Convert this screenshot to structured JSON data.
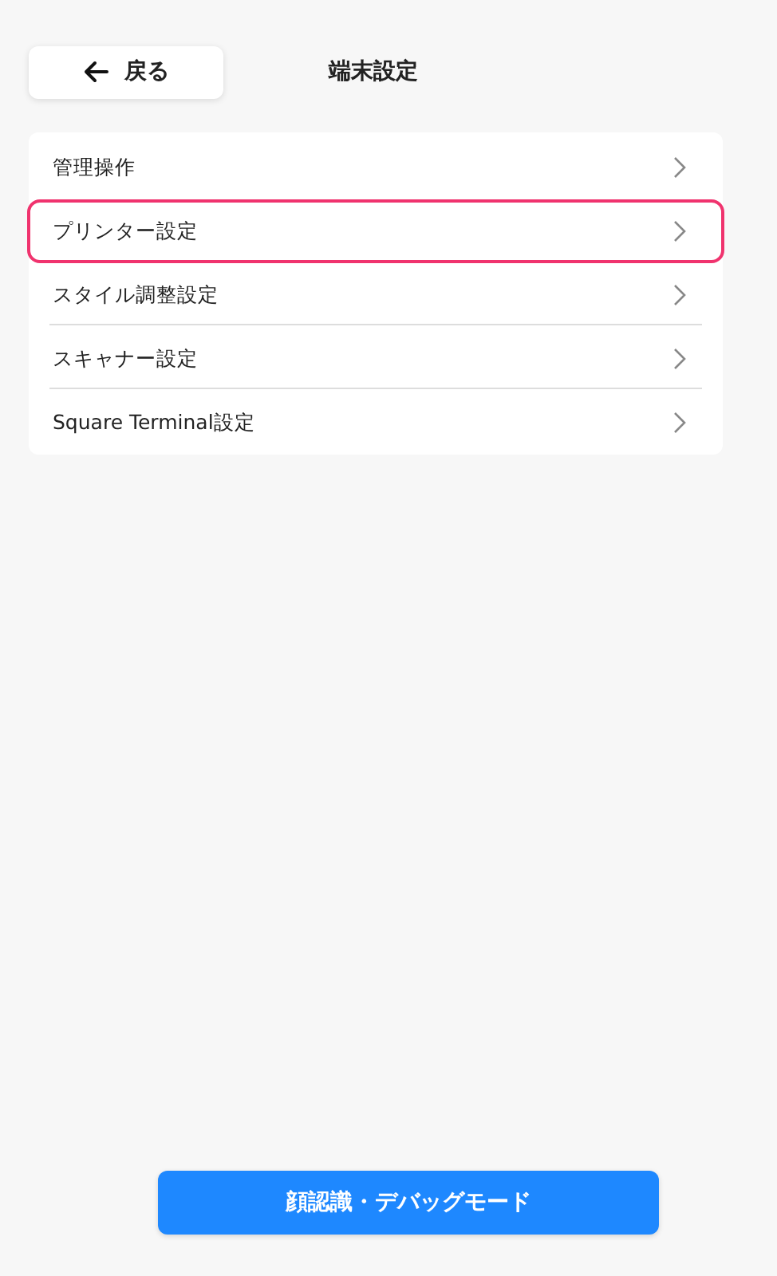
{
  "header": {
    "back_button": "戻る",
    "title": "端末設定"
  },
  "menu_items": [
    {
      "label": "管理操作",
      "selected": false
    },
    {
      "label": "プリンター設定",
      "selected": true
    },
    {
      "label": "スタイル調整設定",
      "selected": false
    },
    {
      "label": "スキャナー設定",
      "selected": false
    },
    {
      "label": "Square Terminal設定",
      "selected": false
    }
  ],
  "footer_button": "顔認識・デバッグモード"
}
